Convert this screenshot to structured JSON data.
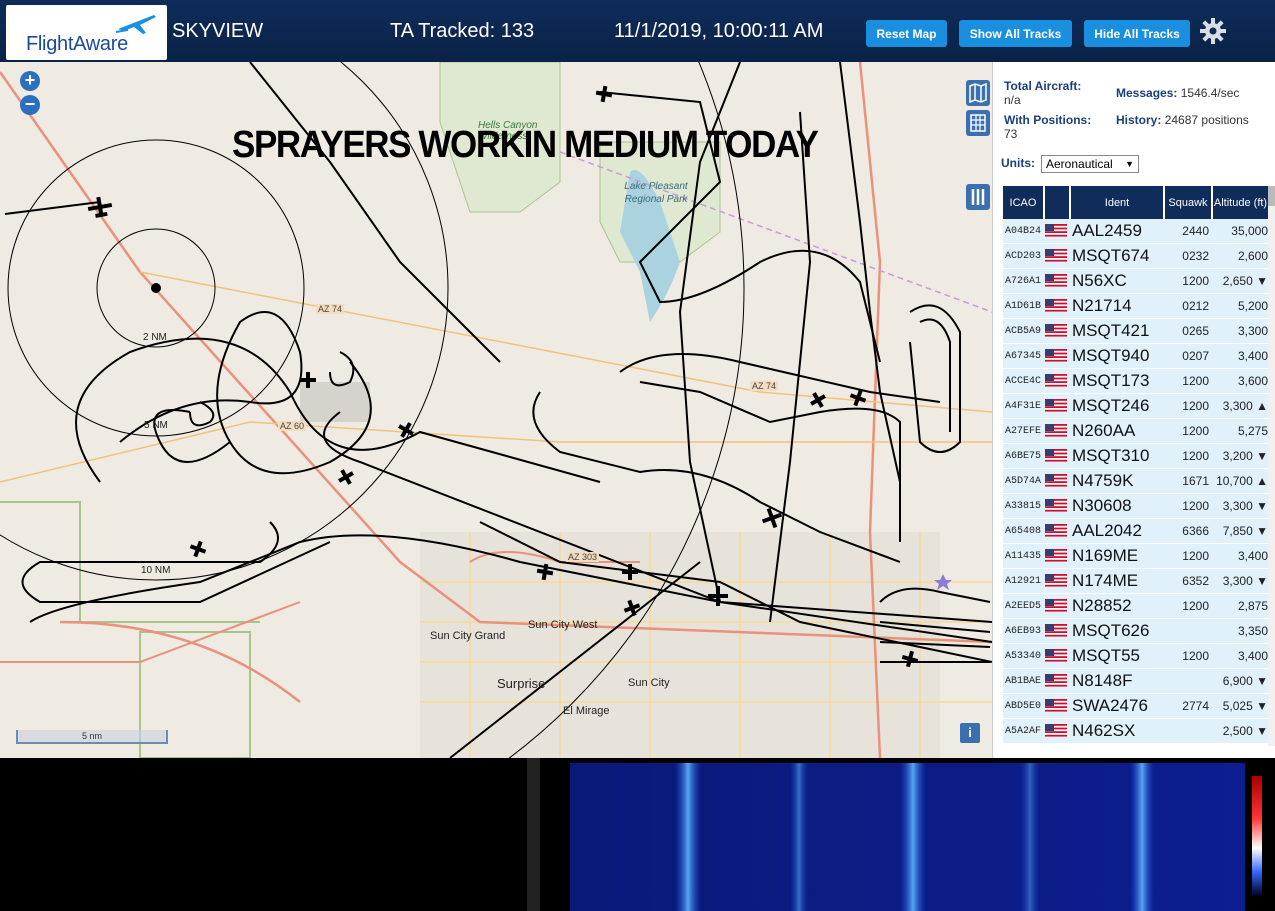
{
  "header": {
    "logo_text": "FlightAware",
    "title": "SKYVIEW",
    "tracked": "TA Tracked: 133",
    "datetime": "11/1/2019, 10:00:11 AM",
    "buttons": [
      "Reset Map",
      "Show All Tracks",
      "Hide All Tracks"
    ],
    "settings_icon": "gear-icon"
  },
  "map": {
    "overlay_message": "SPRAYERS WORKIN MEDIUM TODAY",
    "scale_label": "5 nm",
    "zoom_in": "+",
    "zoom_out": "−",
    "info": "i",
    "range_labels": [
      "2 NM",
      "5 NM",
      "10 NM"
    ],
    "place_labels": [
      "Hells Canyon Wilderness",
      "Lake Pleasant Regional Park",
      "Sun City Grand",
      "Sun City West",
      "Surprise",
      "Sun City",
      "El Mirage",
      "AZ 74",
      "AZ 303",
      "AZ 60"
    ]
  },
  "panel": {
    "total_label": "Total Aircraft:",
    "total_value": "n/a",
    "messages_label": "Messages:",
    "messages_value": "1546.4/sec",
    "positions_label": "With Positions:",
    "positions_value": "73",
    "history_label": "History:",
    "history_value": "24687 positions",
    "units_label": "Units:",
    "units_value": "Aeronautical"
  },
  "table": {
    "headers": [
      "ICAO",
      "",
      "Ident",
      "Squawk",
      "Altitude (ft)"
    ],
    "rows": [
      {
        "icao": "A04B24",
        "ident": "AAL2459",
        "squawk": "2440",
        "alt": "35,000"
      },
      {
        "icao": "ACD203",
        "ident": "MSQT674",
        "squawk": "0232",
        "alt": "2,600"
      },
      {
        "icao": "A726A1",
        "ident": "N56XC",
        "squawk": "1200",
        "alt": "2,650 ▼"
      },
      {
        "icao": "A1D61B",
        "ident": "N21714",
        "squawk": "0212",
        "alt": "5,200"
      },
      {
        "icao": "ACB5A9",
        "ident": "MSQT421",
        "squawk": "0265",
        "alt": "3,300"
      },
      {
        "icao": "A67345",
        "ident": "MSQT940",
        "squawk": "0207",
        "alt": "3,400"
      },
      {
        "icao": "ACCE4C",
        "ident": "MSQT173",
        "squawk": "1200",
        "alt": "3,600"
      },
      {
        "icao": "A4F31E",
        "ident": "MSQT246",
        "squawk": "1200",
        "alt": "3,300 ▲"
      },
      {
        "icao": "A27EFE",
        "ident": "N260AA",
        "squawk": "1200",
        "alt": "5,275"
      },
      {
        "icao": "A6BE75",
        "ident": "MSQT310",
        "squawk": "1200",
        "alt": "3,200 ▼"
      },
      {
        "icao": "A5D74A",
        "ident": "N4759K",
        "squawk": "1671",
        "alt": "10,700 ▲"
      },
      {
        "icao": "A33815",
        "ident": "N30608",
        "squawk": "1200",
        "alt": "3,300 ▼"
      },
      {
        "icao": "A65408",
        "ident": "AAL2042",
        "squawk": "6366",
        "alt": "7,850 ▼"
      },
      {
        "icao": "A11435",
        "ident": "N169ME",
        "squawk": "1200",
        "alt": "3,400"
      },
      {
        "icao": "A12921",
        "ident": "N174ME",
        "squawk": "6352",
        "alt": "3,300 ▼"
      },
      {
        "icao": "A2EED5",
        "ident": "N28852",
        "squawk": "1200",
        "alt": "2,875"
      },
      {
        "icao": "A6EB93",
        "ident": "MSQT626",
        "squawk": "",
        "alt": "3,350"
      },
      {
        "icao": "A53340",
        "ident": "MSQT55",
        "squawk": "1200",
        "alt": "3,400"
      },
      {
        "icao": "AB1BAE",
        "ident": "N8148F",
        "squawk": "",
        "alt": "6,900 ▼"
      },
      {
        "icao": "ABD5E0",
        "ident": "SWA2476",
        "squawk": "2774",
        "alt": "5,025 ▼"
      },
      {
        "icao": "A5A2AF",
        "ident": "N462SX",
        "squawk": "",
        "alt": "2,500 ▼"
      }
    ]
  },
  "colors": {
    "header_bg": "#0f2c5a",
    "button": "#1a8fe0",
    "row_bg": "#e0f1fb",
    "map_bg": "#efeae2"
  }
}
